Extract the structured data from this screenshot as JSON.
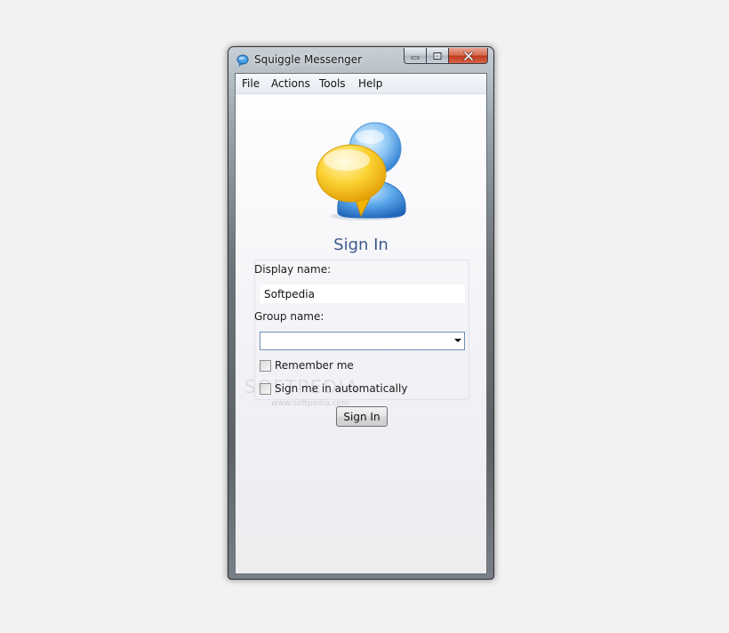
{
  "window": {
    "title": "Squiggle Messenger"
  },
  "menu": {
    "items": [
      "File",
      "Actions",
      "Tools",
      "Help"
    ]
  },
  "signin": {
    "heading": "Sign In",
    "display_name_label": "Display name:",
    "display_name_value": "Softpedia",
    "group_name_label": "Group name:",
    "group_name_value": "",
    "remember_me_label": "Remember me",
    "remember_me_checked": false,
    "auto_sign_in_label": "Sign me in automatically",
    "auto_sign_in_checked": false,
    "button_label": "Sign In"
  },
  "watermark": {
    "text": "SOFTPEDIA",
    "url": "www.softpedia.com"
  },
  "colors": {
    "heading": "#3b5a8a",
    "close_button": "#c0391b",
    "bubble_yellow": "#f5c21c",
    "person_blue": "#3f8fde"
  }
}
